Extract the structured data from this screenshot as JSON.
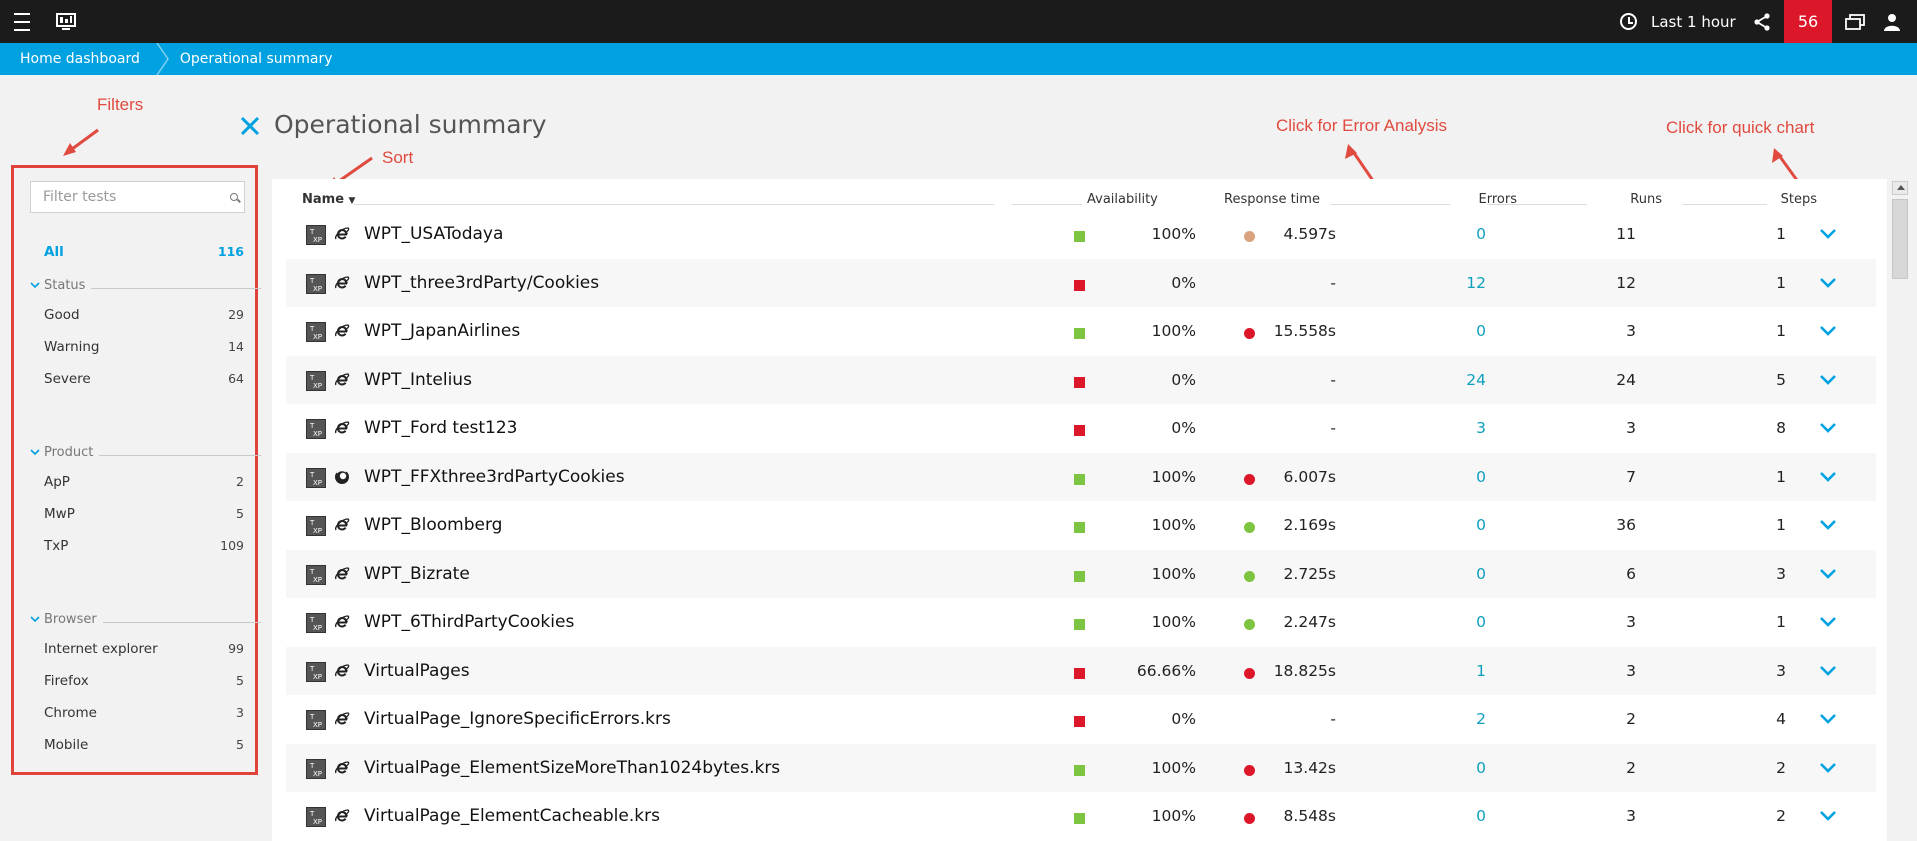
{
  "topbar": {
    "timeframe": "Last 1 hour",
    "problems_count": "56"
  },
  "breadcrumb": {
    "home": "Home dashboard",
    "current": "Operational summary"
  },
  "page": {
    "title": "Operational summary"
  },
  "annotations": {
    "filters": "Filters",
    "sort": "Sort",
    "error_analysis": "Click for Error Analysis",
    "quick_chart": "Click for quick chart"
  },
  "filters": {
    "placeholder": "Filter tests",
    "all": {
      "label": "All",
      "count": "116"
    },
    "groups": [
      {
        "title": "Status",
        "items": [
          {
            "label": "Good",
            "count": "29"
          },
          {
            "label": "Warning",
            "count": "14"
          },
          {
            "label": "Severe",
            "count": "64"
          }
        ]
      },
      {
        "title": "Product",
        "items": [
          {
            "label": "ApP",
            "count": "2"
          },
          {
            "label": "MwP",
            "count": "5"
          },
          {
            "label": "TxP",
            "count": "109"
          }
        ]
      },
      {
        "title": "Browser",
        "items": [
          {
            "label": "Internet explorer",
            "count": "99"
          },
          {
            "label": "Firefox",
            "count": "5"
          },
          {
            "label": "Chrome",
            "count": "3"
          },
          {
            "label": "Mobile",
            "count": "5"
          }
        ]
      }
    ]
  },
  "table": {
    "columns": {
      "name": "Name",
      "availability": "Availability",
      "response_time": "Response time",
      "errors": "Errors",
      "runs": "Runs",
      "steps": "Steps"
    },
    "rows": [
      {
        "name": "WPT_USATodaya",
        "browser": "ie",
        "avail": "100%",
        "avail_status": "good",
        "resp": "4.597s",
        "resp_status": "warning",
        "errors": "0",
        "runs": "11",
        "steps": "1"
      },
      {
        "name": "WPT_three3rdParty/Cookies",
        "browser": "ie",
        "avail": "0%",
        "avail_status": "severe",
        "resp": "-",
        "resp_status": "none",
        "errors": "12",
        "runs": "12",
        "steps": "1"
      },
      {
        "name": "WPT_JapanAirlines",
        "browser": "ie",
        "avail": "100%",
        "avail_status": "good",
        "resp": "15.558s",
        "resp_status": "severe",
        "errors": "0",
        "runs": "3",
        "steps": "1"
      },
      {
        "name": "WPT_Intelius",
        "browser": "ie",
        "avail": "0%",
        "avail_status": "severe",
        "resp": "-",
        "resp_status": "none",
        "errors": "24",
        "runs": "24",
        "steps": "5"
      },
      {
        "name": "WPT_Ford test123",
        "browser": "ie",
        "avail": "0%",
        "avail_status": "severe",
        "resp": "-",
        "resp_status": "none",
        "errors": "3",
        "runs": "3",
        "steps": "8"
      },
      {
        "name": "WPT_FFXthree3rdPartyCookies",
        "browser": "firefox",
        "avail": "100%",
        "avail_status": "good",
        "resp": "6.007s",
        "resp_status": "severe",
        "errors": "0",
        "runs": "7",
        "steps": "1"
      },
      {
        "name": "WPT_Bloomberg",
        "browser": "ie",
        "avail": "100%",
        "avail_status": "good",
        "resp": "2.169s",
        "resp_status": "good",
        "errors": "0",
        "runs": "36",
        "steps": "1"
      },
      {
        "name": "WPT_Bizrate",
        "browser": "ie",
        "avail": "100%",
        "avail_status": "good",
        "resp": "2.725s",
        "resp_status": "good",
        "errors": "0",
        "runs": "6",
        "steps": "3"
      },
      {
        "name": "WPT_6ThirdPartyCookies",
        "browser": "ie",
        "avail": "100%",
        "avail_status": "good",
        "resp": "2.247s",
        "resp_status": "good",
        "errors": "0",
        "runs": "3",
        "steps": "1"
      },
      {
        "name": "VirtualPages",
        "browser": "ie",
        "avail": "66.66%",
        "avail_status": "severe",
        "resp": "18.825s",
        "resp_status": "severe",
        "errors": "1",
        "runs": "3",
        "steps": "3"
      },
      {
        "name": "VirtualPage_IgnoreSpecificErrors.krs",
        "browser": "ie",
        "avail": "0%",
        "avail_status": "severe",
        "resp": "-",
        "resp_status": "none",
        "errors": "2",
        "runs": "2",
        "steps": "4"
      },
      {
        "name": "VirtualPage_ElementSizeMoreThan1024bytes.krs",
        "browser": "ie",
        "avail": "100%",
        "avail_status": "good",
        "resp": "13.42s",
        "resp_status": "severe",
        "errors": "0",
        "runs": "2",
        "steps": "2"
      },
      {
        "name": "VirtualPage_ElementCacheable.krs",
        "browser": "ie",
        "avail": "100%",
        "avail_status": "good",
        "resp": "8.548s",
        "resp_status": "severe",
        "errors": "0",
        "runs": "3",
        "steps": "2"
      }
    ]
  },
  "colors": {
    "accent": "#00a1e0",
    "good": "#7dc540",
    "warning": "#d9a27f",
    "severe": "#dc172a",
    "annotation": "#e04a3f"
  }
}
